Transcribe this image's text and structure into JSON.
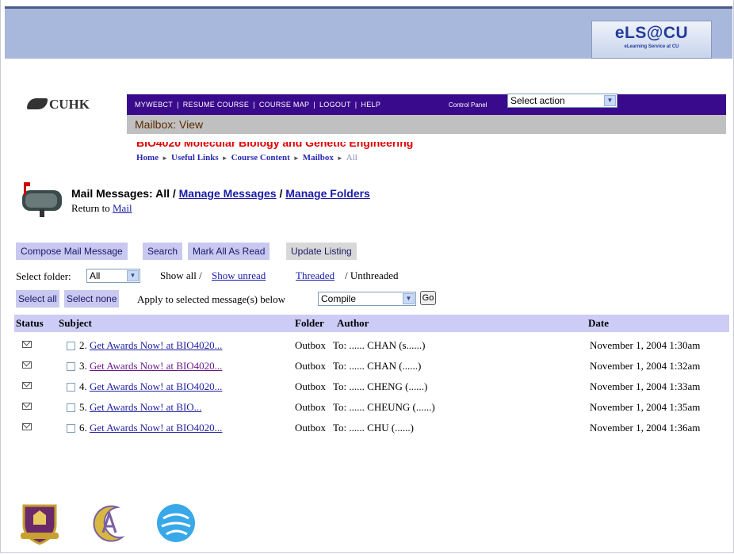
{
  "header": {
    "els_logo_text": "eLS@CU",
    "els_logo_sub": "eLearning Service at CU",
    "cuhk_logo_text": "CUHK"
  },
  "nav": {
    "links": [
      "MYWEBCT",
      "RESUME COURSE",
      "COURSE MAP",
      "LOGOUT",
      "HELP"
    ],
    "control_panel_label": "Control Panel",
    "action_select_value": "Select action"
  },
  "subnav": {
    "text": "Mailbox: View"
  },
  "course": {
    "title": "BIO4020 Molecular Biology and Genetic Engineering"
  },
  "breadcrumb": {
    "items": [
      "Home",
      "Useful Links",
      "Course Content",
      "Mailbox"
    ],
    "current": "All"
  },
  "page": {
    "heading_prefix": "Mail Messages: All /",
    "manage_messages": "Manage Messages",
    "heading_sep": "/",
    "manage_folders": "Manage Folders",
    "return_to": "Return to",
    "return_link": "Mail"
  },
  "toolbar": {
    "compose": "Compose Mail Message",
    "search": "Search",
    "mark_all_read": "Mark All As Read",
    "update_listing": "Update Listing"
  },
  "filters": {
    "select_folder_label": "Select folder:",
    "folder_value": "All",
    "show_all": "Show all /",
    "show_unread": "Show unread",
    "threaded": "Threaded",
    "unthreaded": "/ Unthreaded"
  },
  "actions": {
    "select_all": "Select all",
    "select_none": "Select none",
    "apply_label": "Apply to selected message(s) below",
    "apply_value": "Compile",
    "go": "Go"
  },
  "table": {
    "headers": {
      "status": "Status",
      "subject": "Subject",
      "folder": "Folder",
      "author": "Author",
      "date": "Date"
    },
    "rows": [
      {
        "num": "2.",
        "subject": "Get Awards Now! at BIO4020...",
        "folder": "Outbox",
        "author": "To: ...... CHAN (s......)",
        "date": "November 1, 2004 1:30am"
      },
      {
        "num": "3.",
        "subject": "Get Awards Now! at BIO4020...",
        "folder": "Outbox",
        "author": "To: ...... CHAN (......)",
        "date": "November 1, 2004 1:32am"
      },
      {
        "num": "4.",
        "subject": "Get Awards Now! at BIO4020...",
        "folder": "Outbox",
        "author": "To: ...... CHENG (......)",
        "date": "November 1, 2004 1:33am"
      },
      {
        "num": "5.",
        "subject": "Get Awards Now! at BIO...",
        "folder": "Outbox",
        "author": "To: ...... CHEUNG (......)",
        "date": "November 1, 2004 1:35am"
      },
      {
        "num": "6.",
        "subject": "Get Awards Now! at BIO4020...",
        "folder": "Outbox",
        "author": "To: ...... CHU (......)",
        "date": "November 1, 2004 1:36am"
      }
    ]
  }
}
